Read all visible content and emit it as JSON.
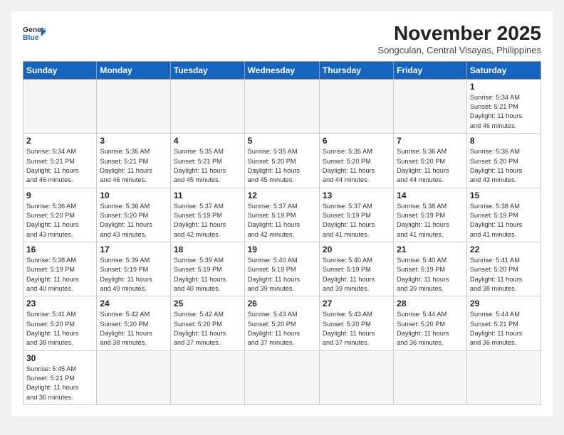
{
  "header": {
    "logo_general": "General",
    "logo_blue": "Blue",
    "month_title": "November 2025",
    "subtitle": "Songculan, Central Visayas, Philippines"
  },
  "weekdays": [
    "Sunday",
    "Monday",
    "Tuesday",
    "Wednesday",
    "Thursday",
    "Friday",
    "Saturday"
  ],
  "weeks": [
    [
      {
        "day": null,
        "info": null
      },
      {
        "day": null,
        "info": null
      },
      {
        "day": null,
        "info": null
      },
      {
        "day": null,
        "info": null
      },
      {
        "day": null,
        "info": null
      },
      {
        "day": null,
        "info": null
      },
      {
        "day": "1",
        "info": "Sunrise: 5:34 AM\nSunset: 5:21 PM\nDaylight: 11 hours\nand 46 minutes."
      }
    ],
    [
      {
        "day": "2",
        "info": "Sunrise: 5:34 AM\nSunset: 5:21 PM\nDaylight: 11 hours\nand 46 minutes."
      },
      {
        "day": "3",
        "info": "Sunrise: 5:35 AM\nSunset: 5:21 PM\nDaylight: 11 hours\nand 46 minutes."
      },
      {
        "day": "4",
        "info": "Sunrise: 5:35 AM\nSunset: 5:21 PM\nDaylight: 11 hours\nand 45 minutes."
      },
      {
        "day": "5",
        "info": "Sunrise: 5:35 AM\nSunset: 5:20 PM\nDaylight: 11 hours\nand 45 minutes."
      },
      {
        "day": "6",
        "info": "Sunrise: 5:35 AM\nSunset: 5:20 PM\nDaylight: 11 hours\nand 44 minutes."
      },
      {
        "day": "7",
        "info": "Sunrise: 5:36 AM\nSunset: 5:20 PM\nDaylight: 11 hours\nand 44 minutes."
      },
      {
        "day": "8",
        "info": "Sunrise: 5:36 AM\nSunset: 5:20 PM\nDaylight: 11 hours\nand 43 minutes."
      }
    ],
    [
      {
        "day": "9",
        "info": "Sunrise: 5:36 AM\nSunset: 5:20 PM\nDaylight: 11 hours\nand 43 minutes."
      },
      {
        "day": "10",
        "info": "Sunrise: 5:36 AM\nSunset: 5:20 PM\nDaylight: 11 hours\nand 43 minutes."
      },
      {
        "day": "11",
        "info": "Sunrise: 5:37 AM\nSunset: 5:19 PM\nDaylight: 11 hours\nand 42 minutes."
      },
      {
        "day": "12",
        "info": "Sunrise: 5:37 AM\nSunset: 5:19 PM\nDaylight: 11 hours\nand 42 minutes."
      },
      {
        "day": "13",
        "info": "Sunrise: 5:37 AM\nSunset: 5:19 PM\nDaylight: 11 hours\nand 41 minutes."
      },
      {
        "day": "14",
        "info": "Sunrise: 5:38 AM\nSunset: 5:19 PM\nDaylight: 11 hours\nand 41 minutes."
      },
      {
        "day": "15",
        "info": "Sunrise: 5:38 AM\nSunset: 5:19 PM\nDaylight: 11 hours\nand 41 minutes."
      }
    ],
    [
      {
        "day": "16",
        "info": "Sunrise: 5:38 AM\nSunset: 5:19 PM\nDaylight: 11 hours\nand 40 minutes."
      },
      {
        "day": "17",
        "info": "Sunrise: 5:39 AM\nSunset: 5:19 PM\nDaylight: 11 hours\nand 40 minutes."
      },
      {
        "day": "18",
        "info": "Sunrise: 5:39 AM\nSunset: 5:19 PM\nDaylight: 11 hours\nand 40 minutes."
      },
      {
        "day": "19",
        "info": "Sunrise: 5:40 AM\nSunset: 5:19 PM\nDaylight: 11 hours\nand 39 minutes."
      },
      {
        "day": "20",
        "info": "Sunrise: 5:40 AM\nSunset: 5:19 PM\nDaylight: 11 hours\nand 39 minutes."
      },
      {
        "day": "21",
        "info": "Sunrise: 5:40 AM\nSunset: 5:19 PM\nDaylight: 11 hours\nand 39 minutes."
      },
      {
        "day": "22",
        "info": "Sunrise: 5:41 AM\nSunset: 5:20 PM\nDaylight: 11 hours\nand 38 minutes."
      }
    ],
    [
      {
        "day": "23",
        "info": "Sunrise: 5:41 AM\nSunset: 5:20 PM\nDaylight: 11 hours\nand 38 minutes."
      },
      {
        "day": "24",
        "info": "Sunrise: 5:42 AM\nSunset: 5:20 PM\nDaylight: 11 hours\nand 38 minutes."
      },
      {
        "day": "25",
        "info": "Sunrise: 5:42 AM\nSunset: 5:20 PM\nDaylight: 11 hours\nand 37 minutes."
      },
      {
        "day": "26",
        "info": "Sunrise: 5:43 AM\nSunset: 5:20 PM\nDaylight: 11 hours\nand 37 minutes."
      },
      {
        "day": "27",
        "info": "Sunrise: 5:43 AM\nSunset: 5:20 PM\nDaylight: 11 hours\nand 37 minutes."
      },
      {
        "day": "28",
        "info": "Sunrise: 5:44 AM\nSunset: 5:20 PM\nDaylight: 11 hours\nand 36 minutes."
      },
      {
        "day": "29",
        "info": "Sunrise: 5:44 AM\nSunset: 5:21 PM\nDaylight: 11 hours\nand 36 minutes."
      }
    ],
    [
      {
        "day": "30",
        "info": "Sunrise: 5:45 AM\nSunset: 5:21 PM\nDaylight: 11 hours\nand 36 minutes."
      },
      {
        "day": null,
        "info": null
      },
      {
        "day": null,
        "info": null
      },
      {
        "day": null,
        "info": null
      },
      {
        "day": null,
        "info": null
      },
      {
        "day": null,
        "info": null
      },
      {
        "day": null,
        "info": null
      }
    ]
  ]
}
